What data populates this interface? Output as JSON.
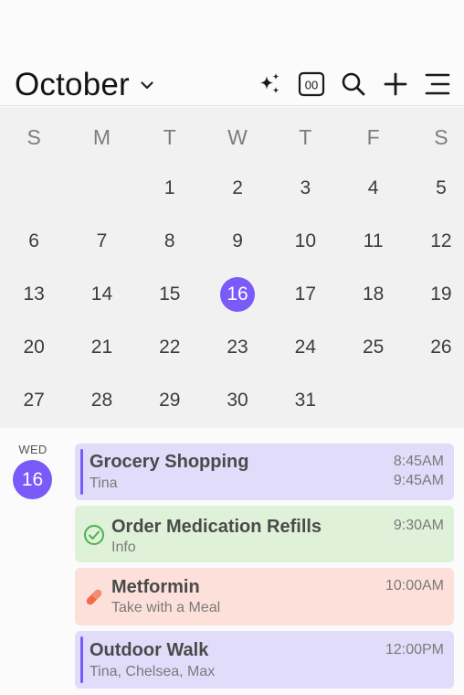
{
  "header": {
    "month": "October",
    "icons": [
      "chevron-down-icon",
      "sparkles-icon",
      "counter-00-icon",
      "search-icon",
      "plus-icon",
      "menu-icon"
    ],
    "counter_text": "00"
  },
  "calendar": {
    "weekdays": [
      "S",
      "M",
      "T",
      "W",
      "T",
      "F",
      "S"
    ],
    "weeks": [
      [
        "",
        "",
        "1",
        "2",
        "3",
        "4",
        "5"
      ],
      [
        "6",
        "7",
        "8",
        "9",
        "10",
        "11",
        "12"
      ],
      [
        "13",
        "14",
        "15",
        "16",
        "17",
        "18",
        "19"
      ],
      [
        "20",
        "21",
        "22",
        "23",
        "24",
        "25",
        "26"
      ],
      [
        "27",
        "28",
        "29",
        "30",
        "31",
        "",
        ""
      ]
    ],
    "today": "16",
    "accent": "#7a5af8"
  },
  "agenda": {
    "weekday": "WED",
    "day": "16",
    "events": [
      {
        "title": "Grocery Shopping",
        "subtitle": "Tina",
        "time_start": "8:45AM",
        "time_end": "9:45AM",
        "bg": "#e1dcfa",
        "icon": ""
      },
      {
        "title": "Order Medication Refills",
        "subtitle": "Info",
        "time_start": "9:30AM",
        "time_end": "",
        "bg": "#dff1d9",
        "icon": "check-circle-icon"
      },
      {
        "title": "Metformin",
        "subtitle": "Take with a Meal",
        "time_start": "10:00AM",
        "time_end": "",
        "bg": "#fde0da",
        "icon": "pill-icon"
      },
      {
        "title": "Outdoor Walk",
        "subtitle": "Tina, Chelsea, Max",
        "time_start": "12:00PM",
        "time_end": "",
        "bg": "#e1dcfa",
        "icon": ""
      }
    ]
  }
}
